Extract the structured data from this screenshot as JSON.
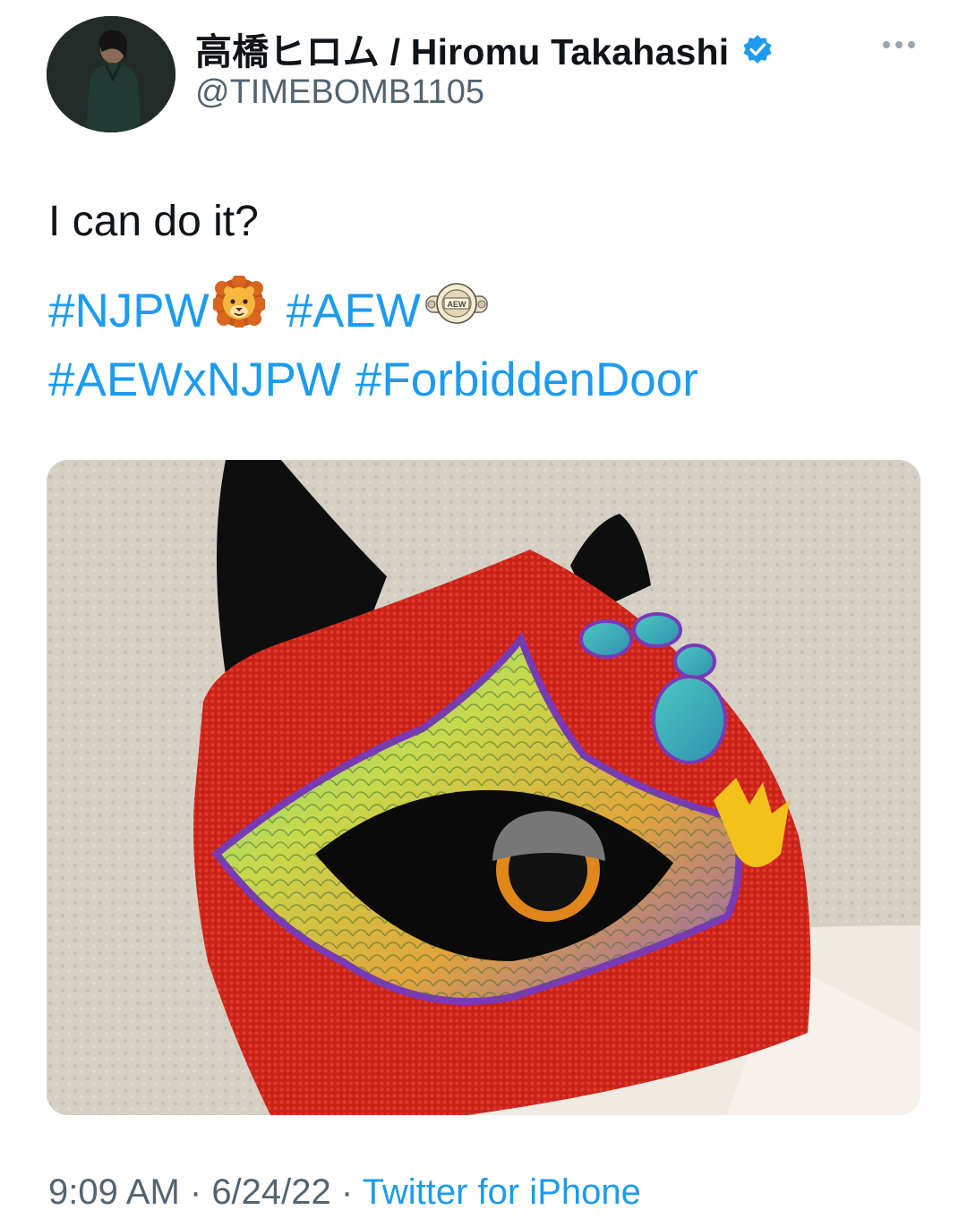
{
  "author": {
    "display_name": "高橋ヒロム / Hiromu Takahashi",
    "handle": "@TIMEBOMB1105",
    "verified": true
  },
  "tweet": {
    "text": "I can do it?",
    "hashtags": [
      "#NJPW",
      "#AEW",
      "#AEWxNJPW",
      "#ForbiddenDoor"
    ],
    "emojis": [
      "lion-emoji",
      "championship-belt-emoji"
    ],
    "belt_label": "AEW"
  },
  "meta": {
    "time": "9:09 AM",
    "separator": " · ",
    "date": "6/24/22",
    "source": "Twitter for iPhone"
  },
  "icons": {
    "more": "more-horizontal-icon",
    "verified": "verified-badge-icon"
  },
  "colors": {
    "link": "#1d9bf0",
    "secondary_text": "#536471",
    "verified": "#1d9bf0"
  }
}
